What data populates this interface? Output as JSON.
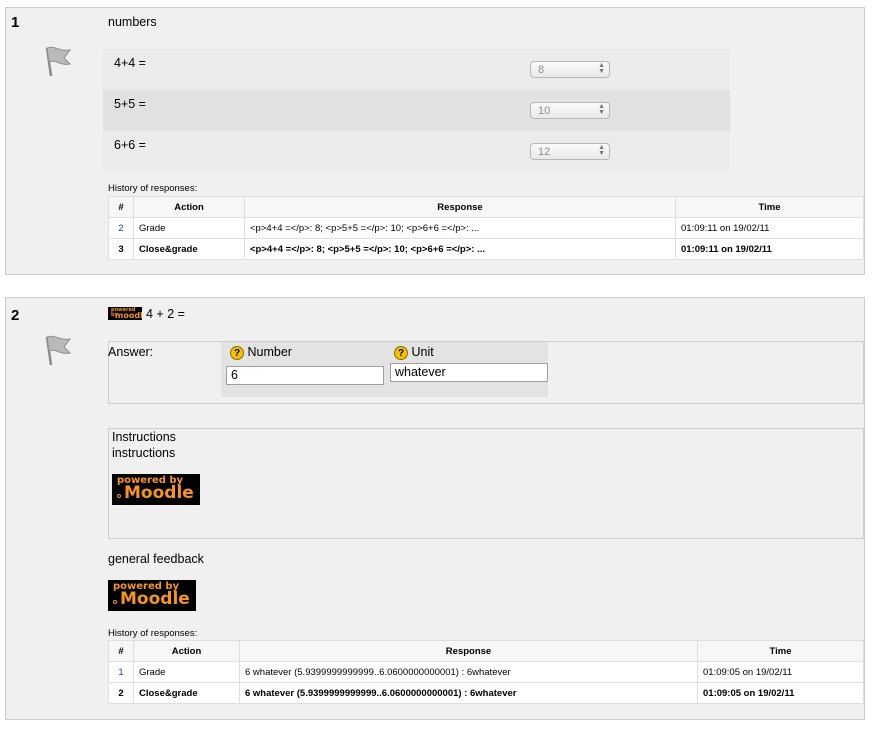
{
  "questions": [
    {
      "number": "1",
      "title": "numbers",
      "rows": [
        {
          "label": "4+4 =",
          "value": "8"
        },
        {
          "label": "5+5 =",
          "value": "10"
        },
        {
          "label": "6+6 =",
          "value": "12"
        }
      ],
      "history_label": "History of responses:",
      "history_headers": [
        "#",
        "Action",
        "Response",
        "Time"
      ],
      "history": [
        {
          "num": "2",
          "action": "Grade",
          "response": "<p>4+4 =</p>: 8; <p>5+5 =</p>: 10; <p>6+6 =</p>: ...",
          "time": "01:09:11 on 19/02/11"
        },
        {
          "num": "3",
          "action": "Close&grade",
          "response": "<p>4+4 =</p>: 8; <p>5+5 =</p>: 10; <p>6+6 =</p>: ...",
          "time": "01:09:11 on 19/02/11"
        }
      ]
    },
    {
      "number": "2",
      "title_logo_text": [
        "powered by",
        "moodle"
      ],
      "title": "4 + 2 =",
      "answer_label": "Answer:",
      "number_label": "Number",
      "unit_label": "Unit",
      "help_icon": "?",
      "number_value": "6",
      "unit_value": "whatever",
      "instructions_heading": "Instructions",
      "instructions_text": "instructions",
      "logo_text": [
        "powered by",
        "Moodle"
      ],
      "general_feedback": "general feedback",
      "history_label": "History of responses:",
      "history_headers": [
        "#",
        "Action",
        "Response",
        "Time"
      ],
      "history": [
        {
          "num": "1",
          "action": "Grade",
          "response": "6 whatever (5.9399999999999..6.0600000000001) : 6whatever",
          "time": "01:09:05 on 19/02/11"
        },
        {
          "num": "2",
          "action": "Close&grade",
          "response": "6 whatever (5.9399999999999..6.0600000000001) : 6whatever",
          "time": "01:09:05 on 19/02/11"
        }
      ]
    }
  ]
}
